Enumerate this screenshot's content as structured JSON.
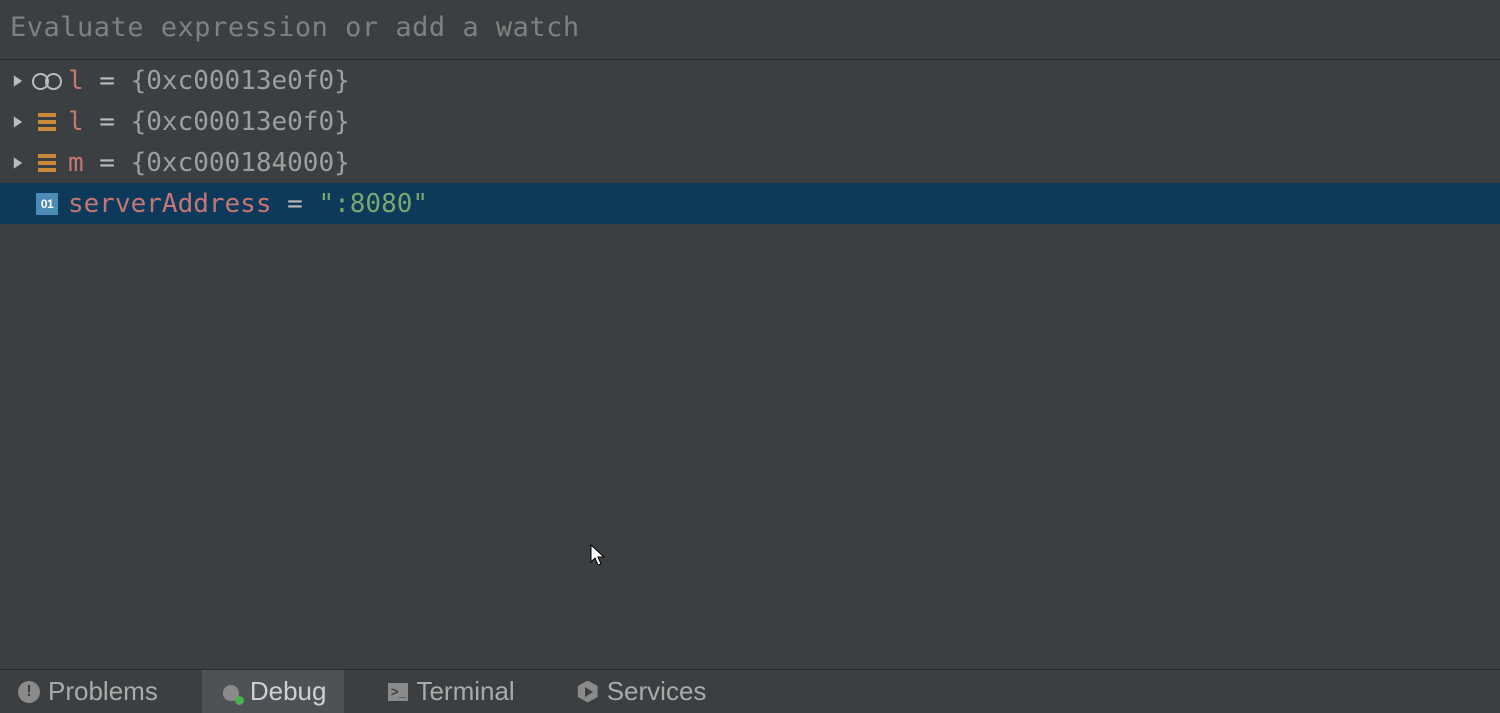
{
  "eval_input": {
    "placeholder": "Evaluate expression or add a watch",
    "value": ""
  },
  "variables": [
    {
      "name": "l",
      "eq": " = ",
      "value": "{0xc00013e0f0}",
      "icon": "watch",
      "expandable": true,
      "selected": false,
      "string": false
    },
    {
      "name": "l",
      "eq": " = ",
      "value": "{0xc00013e0f0}",
      "icon": "struct",
      "expandable": true,
      "selected": false,
      "string": false
    },
    {
      "name": "m",
      "eq": " = ",
      "value": "{0xc000184000}",
      "icon": "struct",
      "expandable": true,
      "selected": false,
      "string": false
    },
    {
      "name": "serverAddress",
      "eq": " = ",
      "value": "\":8080\"",
      "icon": "binary",
      "expandable": false,
      "selected": true,
      "string": true
    }
  ],
  "bottom_tabs": {
    "problems": "Problems",
    "debug": "Debug",
    "terminal": "Terminal",
    "services": "Services",
    "active": "debug"
  }
}
